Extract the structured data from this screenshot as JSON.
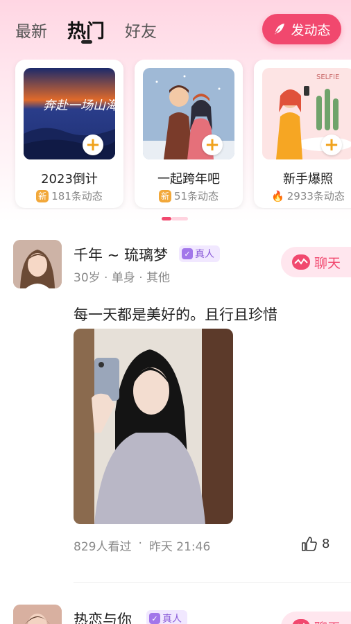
{
  "header": {
    "tabs": [
      "最新",
      "热门",
      "好友"
    ],
    "active_tab": "热门",
    "post_button": "发动态"
  },
  "topics": [
    {
      "title": "2023倒计",
      "count": "181条动态",
      "badge": "新",
      "image_text": "奔赴一场山海"
    },
    {
      "title": "一起跨年吧",
      "count": "51条动态",
      "badge": "新"
    },
    {
      "title": "新手爆照",
      "count": "2933条动态",
      "badge": "fire-icon",
      "image_text": "SELFIE"
    }
  ],
  "feed": [
    {
      "name": "千年 ~ 琉璃梦",
      "verified": "真人",
      "meta": "30岁 · 单身 · 其他",
      "chat": "聊天",
      "text": "每一天都是美好的。且行且珍惜",
      "views": "829人看过",
      "dot": "·",
      "time": "昨天 21:46",
      "likes": "8"
    },
    {
      "name": "热恋与你",
      "verified": "真人",
      "chat": "聊天"
    }
  ],
  "colors": {
    "accent": "#f1486e",
    "verified": "#8a5bd8",
    "badge_new": "#f2a83a"
  }
}
